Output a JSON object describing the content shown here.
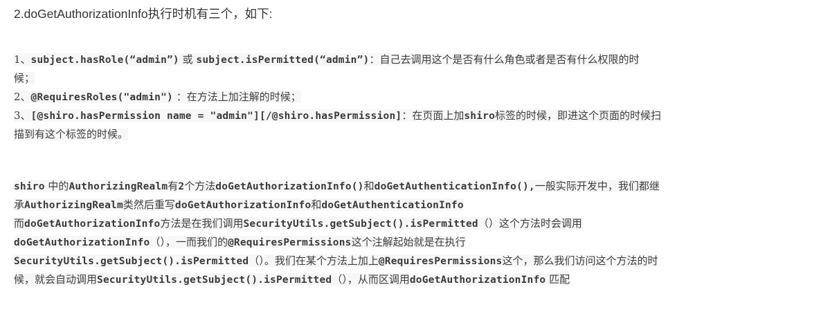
{
  "heading": "2.doGetAuthorizationInfo执行时机有三个，如下:",
  "list": {
    "l1a_prefix": "1、",
    "l1a_code": "subject.hasRole(“admin”)",
    "l1a_or": " 或 ",
    "l1a_code2": "subject.isPermitted(“admin”)",
    "l1a_text": "：自己去调用这个是否有什么角色或者是否有什么权限的时",
    "l1b_text": "候；",
    "l2_prefix": "2、",
    "l2_code": "@RequiresRoles(\"admin\")",
    "l2_text": " ：在方法上加注解的时候；",
    "l3a_prefix": "3、",
    "l3a_code": "[@shiro.hasPermission name = \"admin\"][/@shiro.hasPermission]",
    "l3a_text1": "：在页面上加",
    "l3a_code2": "shiro",
    "l3a_text2": "标签的时候，即进这个页面的时候扫",
    "l3b_text": "描到有这个标签的时候。"
  },
  "para": {
    "p1_code1": "shiro",
    "p1_text1": " 中的",
    "p1_code2": "AuthorizingRealm",
    "p1_text2": "有",
    "p1_code3": "2",
    "p1_text3": "个方法",
    "p1_code4": "doGetAuthorizationInfo()",
    "p1_text4": "和",
    "p1_code5": "doGetAuthenticationInfo(),",
    "p1_text5": "一般实际开发中，我们都继",
    "p2_text1": "承",
    "p2_code1": "AuthorizingRealm",
    "p2_text2": "类然后重写",
    "p2_code2": "doGetAuthorizationInfo",
    "p2_text3": "和",
    "p2_code3": "doGetAuthenticationInfo",
    "p3_text1": "而",
    "p3_code1": "doGetAuthorizationInfo",
    "p3_text2": "方法是在我们调用",
    "p3_code2": "SecurityUtils.getSubject().isPermitted",
    "p3_text3": "（）这个方法时会调用",
    "p4_code1": "doGetAuthorizationInfo",
    "p4_text1": "（），一而我们的",
    "p4_code2": "@RequiresPermissions",
    "p4_text2": "这个注解起始就是在执行",
    "p5_code1": "SecurityUtils.getSubject().isPermitted",
    "p5_text1": "（）。我们在某个方法上加上",
    "p5_code2": "@RequiresPermissions",
    "p5_text2": "这个，那么我们访问这个方法的时",
    "p6_text1": "候，就会自动调用",
    "p6_code1": "SecurityUtils.getSubject().isPermitted",
    "p6_text2": "（），从而区调用",
    "p6_code2": "doGetAuthorizationInfo",
    "p6_text3": " 匹配"
  }
}
